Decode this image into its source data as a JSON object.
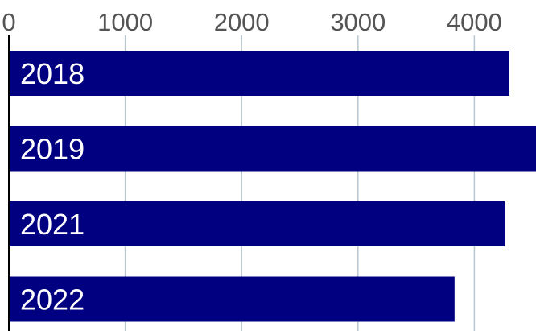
{
  "chart_data": {
    "type": "bar",
    "orientation": "horizontal",
    "categories": [
      "2018",
      "2019",
      "2021",
      "2022"
    ],
    "values": [
      4300,
      4600,
      4260,
      3830
    ],
    "xticks": [
      0,
      1000,
      2000,
      3000,
      4000
    ],
    "xlim": [
      0,
      4500
    ],
    "title": "",
    "xlabel": "",
    "ylabel": "",
    "grid": true,
    "legend": "none",
    "colors": {
      "bar": "#000080",
      "grid": "#b8c7d0",
      "tick_text": "#555555",
      "bar_label_text": "#ffffff"
    }
  }
}
